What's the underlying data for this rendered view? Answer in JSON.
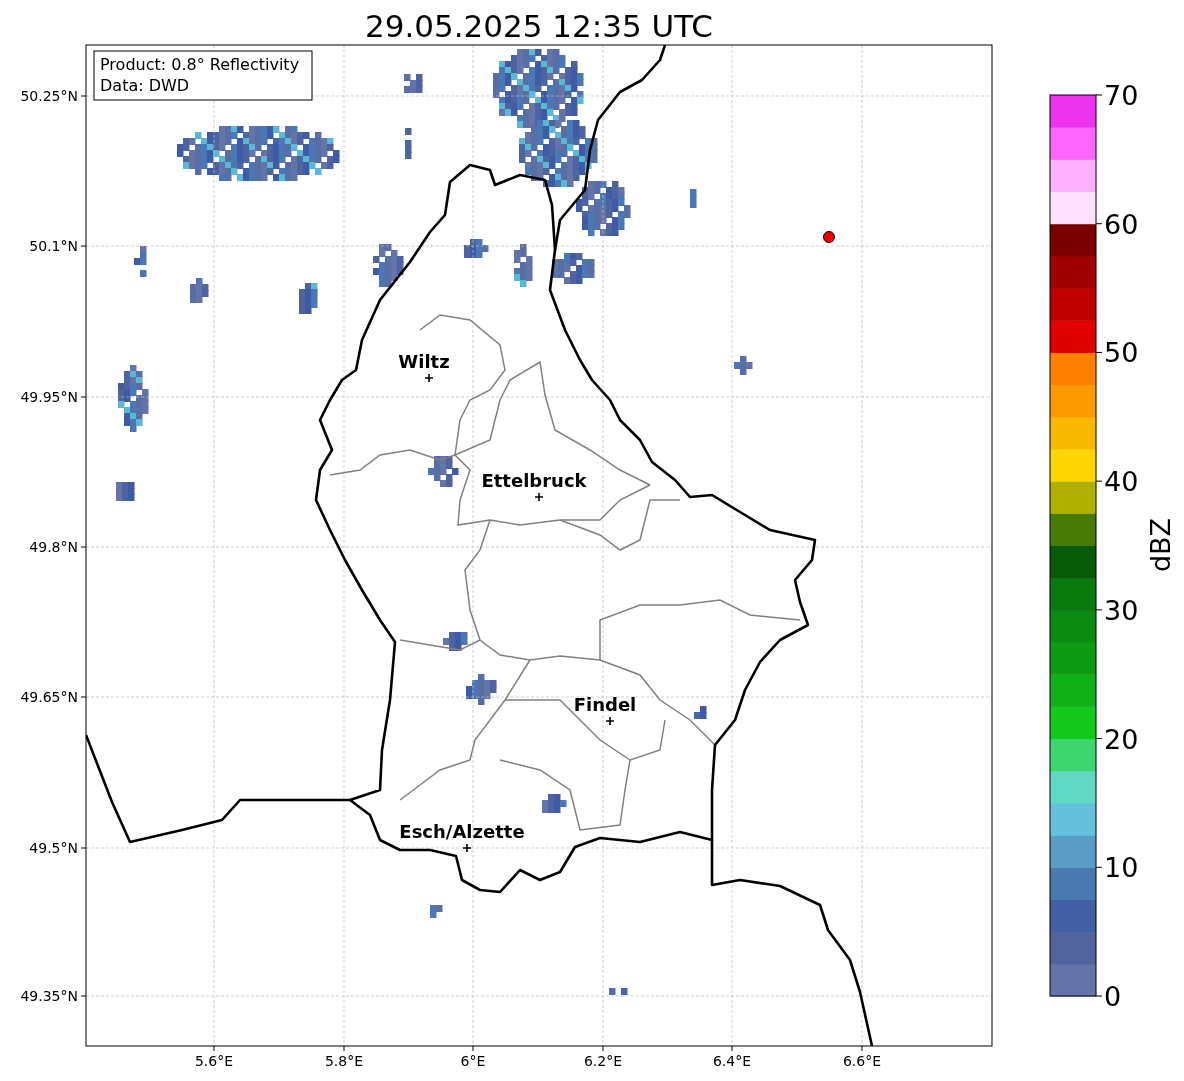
{
  "title": "29.05.2025 12:35 UTC",
  "info_box": [
    "Product: 0.8° Reflectivity",
    "Data: DWD"
  ],
  "map": {
    "x_ticks": [
      "5.6°E",
      "5.8°E",
      "6°E",
      "6.2°E",
      "6.4°E",
      "6.6°E"
    ],
    "y_ticks": [
      "50.25°N",
      "50.1°N",
      "49.95°N",
      "49.8°N",
      "49.65°N",
      "49.5°N",
      "49.35°N"
    ],
    "cities": [
      {
        "name": "Wiltz"
      },
      {
        "name": "Ettelbruck"
      },
      {
        "name": "Findel"
      },
      {
        "name": "Esch/Alzette"
      }
    ]
  },
  "colorbar": {
    "label": "dBZ",
    "ticks": [
      "70",
      "60",
      "50",
      "40",
      "30",
      "20",
      "10",
      "0"
    ]
  }
}
